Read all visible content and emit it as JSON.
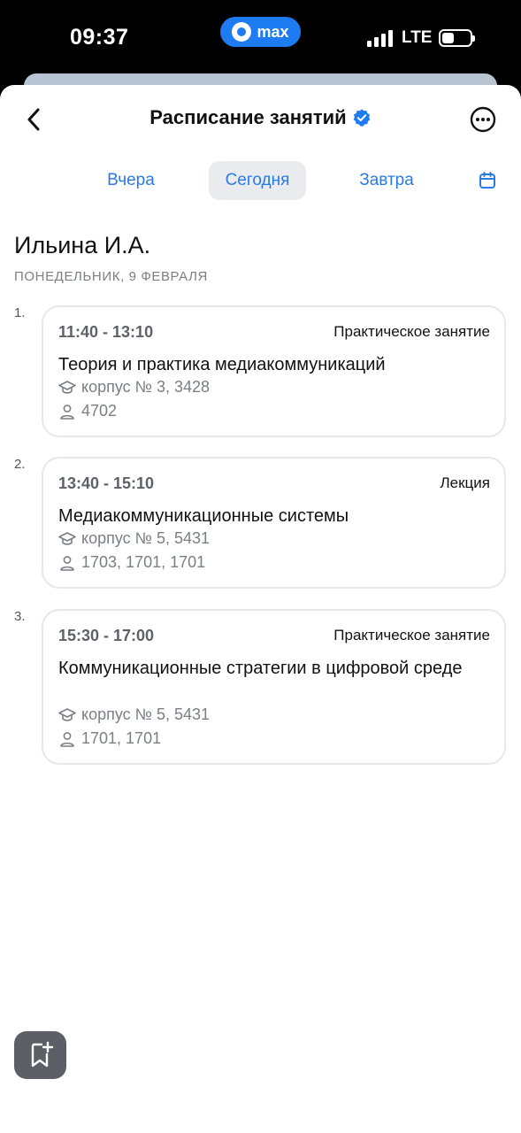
{
  "status_bar": {
    "time": "09:37",
    "app_badge": "max",
    "network": "LTE"
  },
  "header": {
    "title": "Расписание занятий"
  },
  "tabs": [
    {
      "label": "Вчера",
      "selected": false
    },
    {
      "label": "Сегодня",
      "selected": true
    },
    {
      "label": "Завтра",
      "selected": false
    }
  ],
  "teacher": {
    "name": "Ильина И.А.",
    "date": "ПОНЕДЕЛЬНИК, 9 ФЕВРАЛЯ"
  },
  "lessons": [
    {
      "number": "1.",
      "time": "11:40 - 13:10",
      "type": "Практическое занятие",
      "subject": "Теория и практика медиакоммуникаций",
      "location": "корпус № 3, 3428",
      "groups": "4702"
    },
    {
      "number": "2.",
      "time": "13:40 - 15:10",
      "type": "Лекция",
      "subject": "Медиакоммуникационные системы",
      "location": "корпус № 5, 5431",
      "groups": "1703, 1701, 1701"
    },
    {
      "number": "3.",
      "time": "15:30 - 17:00",
      "type": "Практическое занятие",
      "subject": "Коммуникационные стратегии в цифровой среде",
      "location": "корпус № 5, 5431",
      "groups": "1701, 1701"
    }
  ],
  "colors": {
    "accent": "#2a7ae4",
    "verified": "#1e7cf2",
    "muted": "#7a7f87"
  },
  "icons": [
    "back-icon",
    "verified-icon",
    "more-icon",
    "calendar-icon",
    "graduation-cap-icon",
    "person-icon",
    "bookmark-add-icon"
  ]
}
